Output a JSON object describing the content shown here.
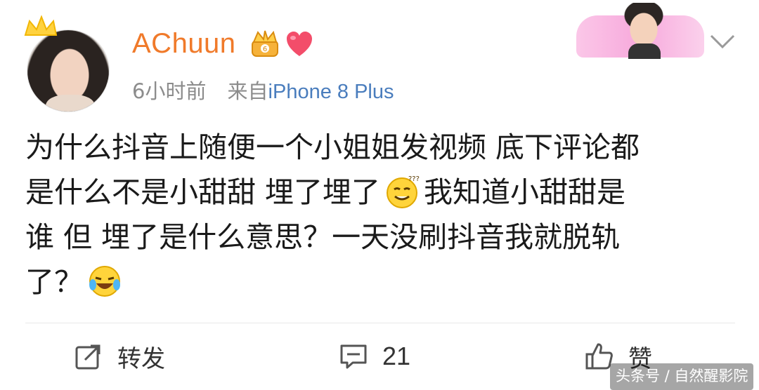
{
  "post": {
    "username": "AChuun",
    "time": "6小时前",
    "source_prefix": "来自",
    "source_device": "iPhone 8 Plus",
    "content_lines": [
      "为什么抖音上随便一个小姐姐发视频 底下评论都",
      "是什么不是小甜甜 埋了埋了",
      "我知道小甜甜是",
      "谁 但 埋了是什么意思？一天没刷抖音我就脱轨",
      "了？"
    ],
    "emojis": [
      "confused-face-emoji",
      "laughing-crying-emoji"
    ]
  },
  "toolbar": {
    "repost_label": "转发",
    "comment_count": "21",
    "like_label": "赞"
  },
  "watermark": "头条号 / 自然醒影院",
  "icons": {
    "vip": "crown-badge-icon",
    "heart": "heart-icon",
    "chevron": "chevron-down-icon",
    "repost": "repost-icon",
    "comment": "comment-icon",
    "like": "thumbs-up-icon"
  },
  "colors": {
    "username": "#f07a2a",
    "device": "#4a7dbd",
    "meta": "#8c8c8c"
  }
}
